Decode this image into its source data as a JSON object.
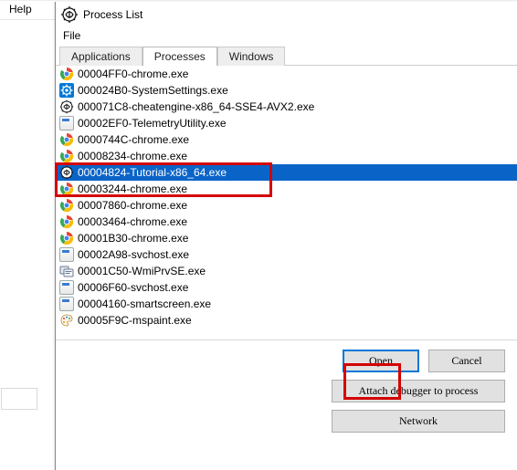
{
  "background_menu": {
    "help": "Help"
  },
  "dialog": {
    "title": "Process List",
    "menu": {
      "file": "File"
    },
    "tabs": [
      {
        "id": "applications",
        "label": "Applications",
        "active": false
      },
      {
        "id": "processes",
        "label": "Processes",
        "active": true
      },
      {
        "id": "windows",
        "label": "Windows",
        "active": false
      }
    ],
    "processes": [
      {
        "icon": "chrome",
        "label": "00004FF0-chrome.exe",
        "selected": false
      },
      {
        "icon": "settings",
        "label": "000024B0-SystemSettings.exe",
        "selected": false
      },
      {
        "icon": "ce",
        "label": "000071C8-cheatengine-x86_64-SSE4-AVX2.exe",
        "selected": false
      },
      {
        "icon": "generic",
        "label": "00002EF0-TelemetryUtility.exe",
        "selected": false
      },
      {
        "icon": "chrome",
        "label": "0000744C-chrome.exe",
        "selected": false
      },
      {
        "icon": "chrome",
        "label": "00008234-chrome.exe",
        "selected": false
      },
      {
        "icon": "tutorial",
        "label": "00004824-Tutorial-x86_64.exe",
        "selected": true
      },
      {
        "icon": "chrome",
        "label": "00003244-chrome.exe",
        "selected": false
      },
      {
        "icon": "chrome",
        "label": "00007860-chrome.exe",
        "selected": false
      },
      {
        "icon": "chrome",
        "label": "00003464-chrome.exe",
        "selected": false
      },
      {
        "icon": "chrome",
        "label": "00001B30-chrome.exe",
        "selected": false
      },
      {
        "icon": "generic",
        "label": "00002A98-svchost.exe",
        "selected": false
      },
      {
        "icon": "wmi",
        "label": "00001C50-WmiPrvSE.exe",
        "selected": false
      },
      {
        "icon": "generic",
        "label": "00006F60-svchost.exe",
        "selected": false
      },
      {
        "icon": "generic",
        "label": "00004160-smartscreen.exe",
        "selected": false
      },
      {
        "icon": "mspaint",
        "label": "00005F9C-mspaint.exe",
        "selected": false
      }
    ],
    "buttons": {
      "open": "Open",
      "cancel": "Cancel",
      "attach": "Attach debugger to process",
      "network": "Network"
    }
  }
}
